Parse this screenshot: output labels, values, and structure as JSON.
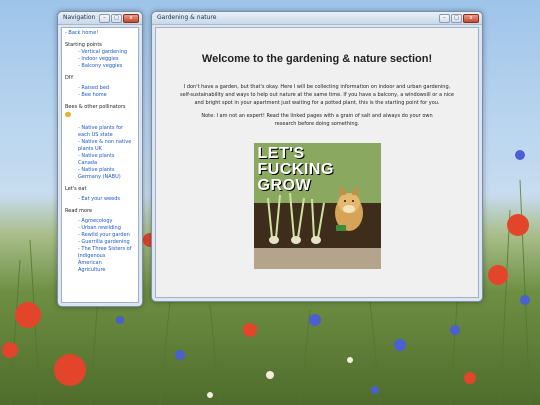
{
  "nav_window": {
    "title": "Navigation",
    "back_link": "- Back home!",
    "sections": [
      {
        "heading": "Starting points",
        "links": [
          "- Vertical gardening",
          "- Indoor veggies",
          "- Balcony veggies"
        ]
      },
      {
        "heading": "DIY",
        "links": [
          "- Raised bed",
          "- Bee home"
        ]
      },
      {
        "heading": "Bees & other pollinators",
        "links": [
          "- Native plants for",
          "each US state",
          "- Native & non native",
          "plants UK",
          "- Native plants",
          "Canada",
          "- Native plants",
          "Germany (NABU)"
        ]
      },
      {
        "heading": "Let's eat",
        "links": [
          "- Eat your weeds"
        ]
      },
      {
        "heading": "Read more",
        "links": [
          "- Agroecology",
          "- Urban rewilding",
          "- Rewild your garden",
          "- Guerrilla gardening",
          "- The Three Sisters of",
          "Indigenous",
          "American",
          "Agriculture"
        ]
      }
    ]
  },
  "main_window": {
    "title": "Gardening & nature",
    "heading": "Welcome to the gardening & nature section!",
    "intro": "I don't have a garden, but that's okay. Here I will be collecting information on indoor and urban gardening, self-sustainability and ways to help out nature at the same time. If you have a balcony, a windowsill or a nice and bright spot in your apartment just waiting for a potted plant, this is the starting point for you.",
    "note": "Note: I am not an expert! Read the linked pages with a grain of salt and always do your own research before doing something.",
    "image": {
      "line1": "LET'S",
      "line2": "FUCKING",
      "line3": "GROW"
    }
  },
  "window_controls": {
    "minimize": "–",
    "maximize": "□",
    "close": "x"
  },
  "colors": {
    "link": "#1a57c9",
    "titlebar": "#c9d8ea",
    "close": "#c24a31"
  }
}
